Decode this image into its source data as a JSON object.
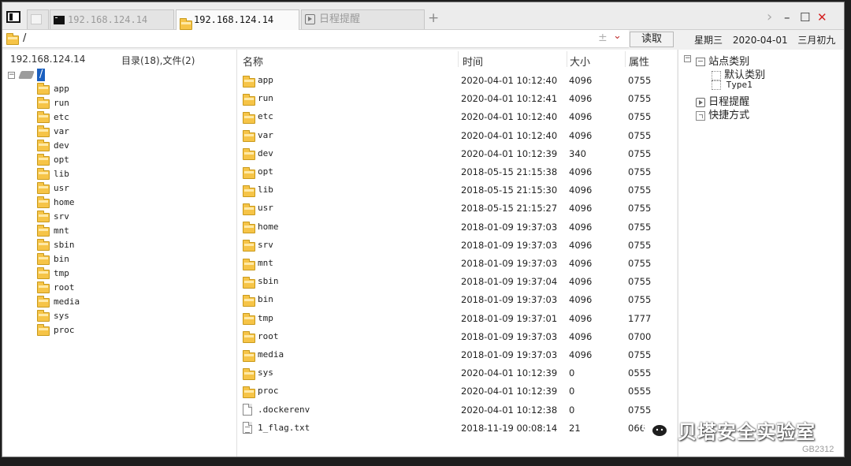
{
  "tabs": [
    {
      "label": "",
      "icon": "blank-tab-icon",
      "active": false
    },
    {
      "label": "192.168.124.14",
      "icon": "terminal-icon",
      "active": false
    },
    {
      "label": "192.168.124.14",
      "icon": "folder-icon",
      "active": true
    },
    {
      "label": "日程提醒",
      "icon": "schedule-icon",
      "active": false
    }
  ],
  "tabbar": {
    "add_symbol": "+",
    "scroll_symbol": "›",
    "min_symbol": "–",
    "max_symbol": "☐",
    "close_symbol": "✕"
  },
  "address": {
    "path": "/",
    "pin_symbol": "±",
    "dropdown_symbol": "⌄",
    "read_button": "读取"
  },
  "calendar": {
    "weekday": "星期三",
    "date": "2020-04-01",
    "lunar": "三月初九"
  },
  "tree": {
    "host": "192.168.124.14",
    "summary": "目录(18),文件(2)",
    "root_label": "/",
    "items": [
      "app",
      "run",
      "etc",
      "var",
      "dev",
      "opt",
      "lib",
      "usr",
      "home",
      "srv",
      "mnt",
      "sbin",
      "bin",
      "tmp",
      "root",
      "media",
      "sys",
      "proc"
    ]
  },
  "list": {
    "columns": {
      "name": "名称",
      "time": "时间",
      "size": "大小",
      "attr": "属性"
    },
    "rows": [
      {
        "name": "app",
        "time": "2020-04-01 10:12:40",
        "size": "4096",
        "attr": "0755",
        "type": "folder"
      },
      {
        "name": "run",
        "time": "2020-04-01 10:12:41",
        "size": "4096",
        "attr": "0755",
        "type": "folder"
      },
      {
        "name": "etc",
        "time": "2020-04-01 10:12:40",
        "size": "4096",
        "attr": "0755",
        "type": "folder"
      },
      {
        "name": "var",
        "time": "2020-04-01 10:12:40",
        "size": "4096",
        "attr": "0755",
        "type": "folder"
      },
      {
        "name": "dev",
        "time": "2020-04-01 10:12:39",
        "size": "340",
        "attr": "0755",
        "type": "folder"
      },
      {
        "name": "opt",
        "time": "2018-05-15 21:15:38",
        "size": "4096",
        "attr": "0755",
        "type": "folder"
      },
      {
        "name": "lib",
        "time": "2018-05-15 21:15:30",
        "size": "4096",
        "attr": "0755",
        "type": "folder"
      },
      {
        "name": "usr",
        "time": "2018-05-15 21:15:27",
        "size": "4096",
        "attr": "0755",
        "type": "folder"
      },
      {
        "name": "home",
        "time": "2018-01-09 19:37:03",
        "size": "4096",
        "attr": "0755",
        "type": "folder"
      },
      {
        "name": "srv",
        "time": "2018-01-09 19:37:03",
        "size": "4096",
        "attr": "0755",
        "type": "folder"
      },
      {
        "name": "mnt",
        "time": "2018-01-09 19:37:03",
        "size": "4096",
        "attr": "0755",
        "type": "folder"
      },
      {
        "name": "sbin",
        "time": "2018-01-09 19:37:04",
        "size": "4096",
        "attr": "0755",
        "type": "folder"
      },
      {
        "name": "bin",
        "time": "2018-01-09 19:37:03",
        "size": "4096",
        "attr": "0755",
        "type": "folder"
      },
      {
        "name": "tmp",
        "time": "2018-01-09 19:37:01",
        "size": "4096",
        "attr": "1777",
        "type": "folder"
      },
      {
        "name": "root",
        "time": "2018-01-09 19:37:03",
        "size": "4096",
        "attr": "0700",
        "type": "folder"
      },
      {
        "name": "media",
        "time": "2018-01-09 19:37:03",
        "size": "4096",
        "attr": "0755",
        "type": "folder"
      },
      {
        "name": "sys",
        "time": "2020-04-01 10:12:39",
        "size": "0",
        "attr": "0555",
        "type": "folder"
      },
      {
        "name": "proc",
        "time": "2020-04-01 10:12:39",
        "size": "0",
        "attr": "0555",
        "type": "folder"
      },
      {
        "name": ".dockerenv",
        "time": "2020-04-01 10:12:38",
        "size": "0",
        "attr": "0755",
        "type": "file"
      },
      {
        "name": "1_flag.txt",
        "time": "2018-11-19 00:08:14",
        "size": "21",
        "attr": "066",
        "type": "text-file"
      }
    ]
  },
  "right_panel": {
    "site_category": "站点类别",
    "default_category": "默认类别",
    "type1": "Type1",
    "schedule": "日程提醒",
    "shortcuts": "快捷方式"
  },
  "watermark": {
    "text": "贝塔安全实验室",
    "code": "GB2312"
  },
  "colors": {
    "selection": "#1a5fbf",
    "folder": "#f6c447",
    "close": "#d42020"
  }
}
